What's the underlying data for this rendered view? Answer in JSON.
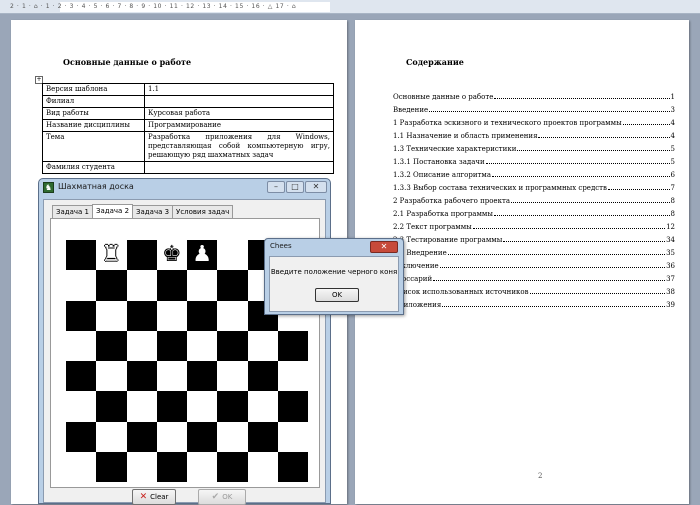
{
  "ruler": {
    "text": "2 · 1 · ⌂ · 1 · 2 · 3 · 4 · 5 · 6 · 7 · 8 · 9 · 10 · 11 · 12 · 13 · 14 · 15 · 16 · △ 17 · ⌂"
  },
  "page1": {
    "heading": "Основные данные о работе",
    "table": [
      {
        "key": "Версия шаблона",
        "value": "1.1"
      },
      {
        "key": "Филиал",
        "value": ""
      },
      {
        "key": "Вид работы",
        "value": "Курсовая работа"
      },
      {
        "key": "Название дисциплины",
        "value": "Программирование"
      },
      {
        "key": "Тема",
        "value": "Разработка приложения для Windows, представляющая собой компьютерную игру, решающую ряд шахматных задач"
      },
      {
        "key": "Фамилия студента",
        "value": ""
      }
    ]
  },
  "page2": {
    "heading": "Содержание",
    "toc": [
      {
        "text": "Основные данные о работе",
        "page": "1"
      },
      {
        "text": "Введение",
        "page": "3"
      },
      {
        "text": "1 Разработка эскизного и технического проектов программы",
        "page": "4"
      },
      {
        "text": "1.1 Назначение и область применения",
        "page": "4"
      },
      {
        "text": "1.3 Технические характеристики",
        "page": "5"
      },
      {
        "text": "1.3.1 Постановка задачи",
        "page": "5"
      },
      {
        "text": "1.3.2 Описание алгоритма",
        "page": "6"
      },
      {
        "text": "1.3.3 Выбор состава технических и программных средств",
        "page": "7"
      },
      {
        "text": "2 Разработка рабочего проекта",
        "page": "8"
      },
      {
        "text": "2.1 Разработка программы",
        "page": "8"
      },
      {
        "text": "2.2 Текст программы",
        "page": "12"
      },
      {
        "text": "2.3 Тестирование программы",
        "page": "34"
      },
      {
        "text": "2.4 Внедрение",
        "page": "35"
      },
      {
        "text": "Заключение",
        "page": "36"
      },
      {
        "text": "Глоссарий",
        "page": "37"
      },
      {
        "text": "Список использованных источников",
        "page": "38"
      },
      {
        "text": "Приложения",
        "page": "39"
      }
    ],
    "page_number": "2"
  },
  "chess_window": {
    "title": "Шахматная доска",
    "app_icon": "chess-app-icon",
    "controls": {
      "minimize": "–",
      "maximize": "□",
      "close": "✕"
    },
    "tabs": [
      "Задача 1",
      "Задача 2",
      "Задача 3",
      "Условия задач"
    ],
    "active_tab": 1,
    "board": {
      "top_row_pieces": [
        {
          "col": 1,
          "glyph": "♜",
          "color": "white",
          "name": "white-rook-icon"
        },
        {
          "col": 3,
          "glyph": "♚",
          "color": "black",
          "name": "black-king-icon"
        },
        {
          "col": 4,
          "glyph": "♟",
          "color": "white",
          "name": "white-pawn-icon"
        }
      ]
    },
    "clear_label": "Clear",
    "ok_label": "OK"
  },
  "message_box": {
    "title": "Chees",
    "close": "✕",
    "text": "Введите положение черного коня",
    "ok_label": "OK"
  }
}
